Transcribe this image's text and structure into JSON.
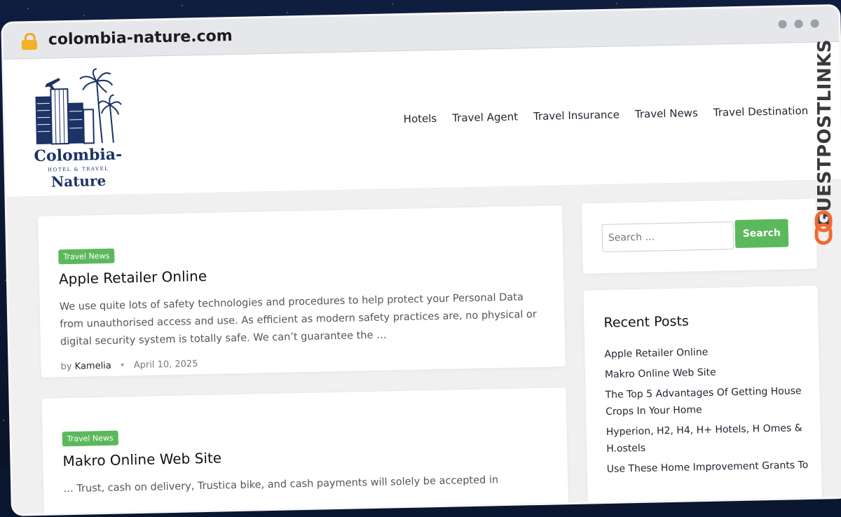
{
  "browser": {
    "url": "colombia-nature.com"
  },
  "logo": {
    "line1": "Colombia-",
    "subtitle": "HOTEL & TRAVEL",
    "line2": "Nature"
  },
  "nav": [
    "Hotels",
    "Travel Agent",
    "Travel Insurance",
    "Travel News",
    "Travel Destination"
  ],
  "posts": [
    {
      "category": "Travel News",
      "title": "Apple Retailer Online",
      "excerpt": "We use quite lots of safety technologies and procedures to help protect your Personal Data from unauthorised access and use. As efficient as modern safety practices are, no physical or digital security system is totally safe. We can’t guarantee the …",
      "by": "by",
      "author": "Kamelia",
      "date": "April 10, 2025"
    },
    {
      "category": "Travel News",
      "title": "Makro Online Web Site",
      "excerpt": "… Trust, cash on delivery, Trustica bike, and cash payments will solely be accepted in"
    }
  ],
  "search": {
    "placeholder": "Search …",
    "button": "Search"
  },
  "recent": {
    "title": "Recent Posts",
    "items": [
      "Apple Retailer Online",
      "Makro Online Web Site",
      "The Top 5 Advantages Of Getting House Crops In Your Home",
      "Hyperion, H2, H4, H+ Hotels, H Omes & H.ostels",
      "Use These Home Improvement Grants To"
    ]
  },
  "watermark": {
    "text": "GUESTPOSTLINKS"
  },
  "colors": {
    "accent": "#5cb85c",
    "brand": "#1c3365",
    "watermark_icon": "#f06a35"
  }
}
